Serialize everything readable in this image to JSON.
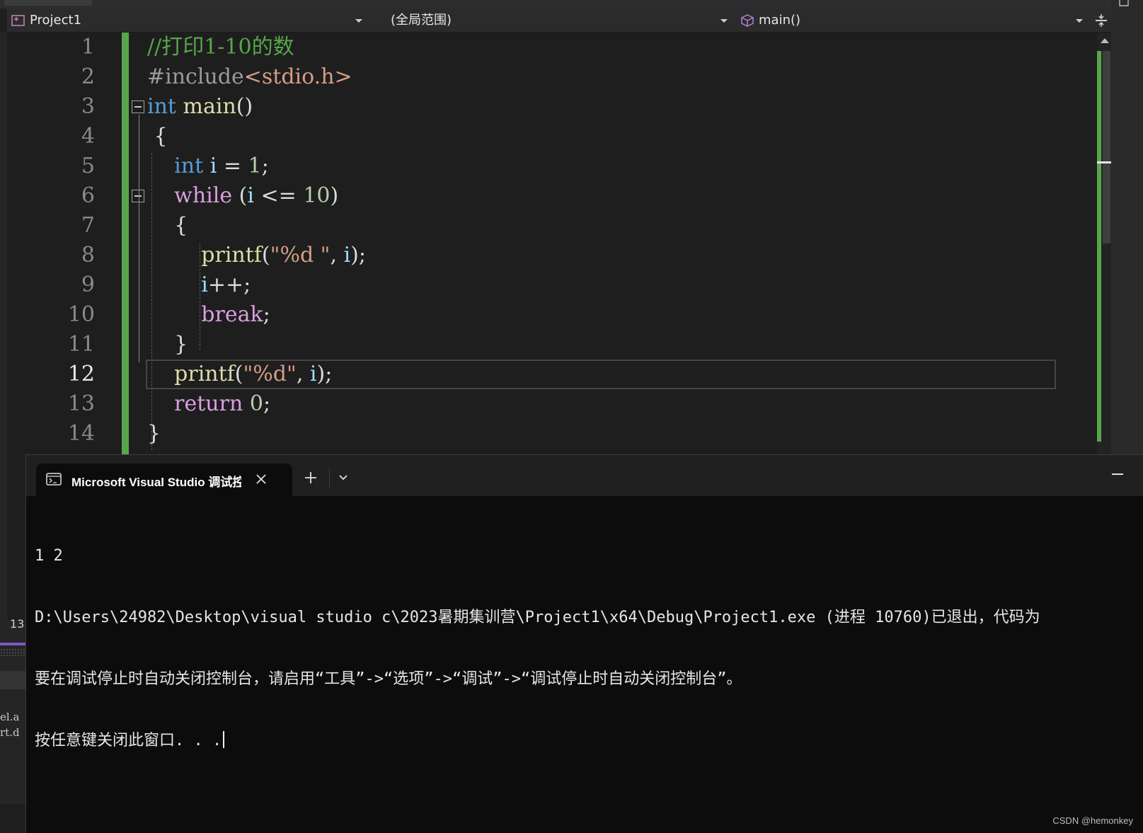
{
  "navbar": {
    "project": "Project1",
    "scope": "(全局范围)",
    "member": "main()"
  },
  "editor": {
    "active_line": 12,
    "lines": [
      {
        "n": "1"
      },
      {
        "n": "2"
      },
      {
        "n": "3"
      },
      {
        "n": "4"
      },
      {
        "n": "5"
      },
      {
        "n": "6"
      },
      {
        "n": "7"
      },
      {
        "n": "8"
      },
      {
        "n": "9"
      },
      {
        "n": "10"
      },
      {
        "n": "11"
      },
      {
        "n": "12"
      },
      {
        "n": "13"
      },
      {
        "n": "14"
      }
    ],
    "tokens": {
      "l1": "//打印1-10的数",
      "l2_pre": "#include",
      "l2_inc": "<stdio.h>",
      "l3_kw": "int",
      "l3_fn": "main",
      "l3_p": "()",
      "l4": "{",
      "l5_kw": "int",
      "l5_var": "i",
      "l5_op": " = ",
      "l5_num": "1",
      "l5_end": ";",
      "l6_kw": "while",
      "l6_p1": " (",
      "l6_var": "i",
      "l6_op": " <= ",
      "l6_num": "10",
      "l6_p2": ")",
      "l7": "{",
      "l8_fn": "printf",
      "l8_p1": "(",
      "l8_str": "\"%d \"",
      "l8_c": ", ",
      "l8_var": "i",
      "l8_p2": ");",
      "l9_var": "i",
      "l9_op": "++;",
      "l10_kw": "break",
      "l10_end": ";",
      "l11": "}",
      "l12_fn": "printf",
      "l12_p1": "(",
      "l12_str": "\"%d\"",
      "l12_c": ", ",
      "l12_var": "i",
      "l12_p2": ");",
      "l13_kw": "return",
      "l13_sp": " ",
      "l13_num": "0",
      "l13_end": ";",
      "l14": "}"
    }
  },
  "left_remnants": {
    "line_number": "13",
    "text1": "el.a",
    "text2": "rt.d"
  },
  "terminal": {
    "tab_title": "Microsoft Visual Studio 调试控制台",
    "output": [
      "1 2",
      "D:\\Users\\24982\\Desktop\\visual studio c\\2023暑期集训营\\Project1\\x64\\Debug\\Project1.exe (进程 10760)已退出，代码为",
      "要在调试停止时自动关闭控制台，请启用“工具”->“选项”->“调试”->“调试停止时自动关闭控制台”。",
      "按任意键关闭此窗口. . ."
    ]
  },
  "watermark": "CSDN @hemonkey",
  "colors": {
    "editor_bg": "#1e1e1e",
    "comment": "#57a64a",
    "keyword": "#569cd6",
    "control": "#d8a0df",
    "function": "#dcdcaa",
    "variable": "#9cdcfe",
    "number": "#b5cea8",
    "string": "#d69d85",
    "terminal_bg": "#0c0c0c"
  },
  "icons": [
    "project-icon",
    "cube-icon",
    "split-icon",
    "terminal-icon",
    "close-icon",
    "plus-icon",
    "chevron-down-icon",
    "minimize-icon"
  ]
}
